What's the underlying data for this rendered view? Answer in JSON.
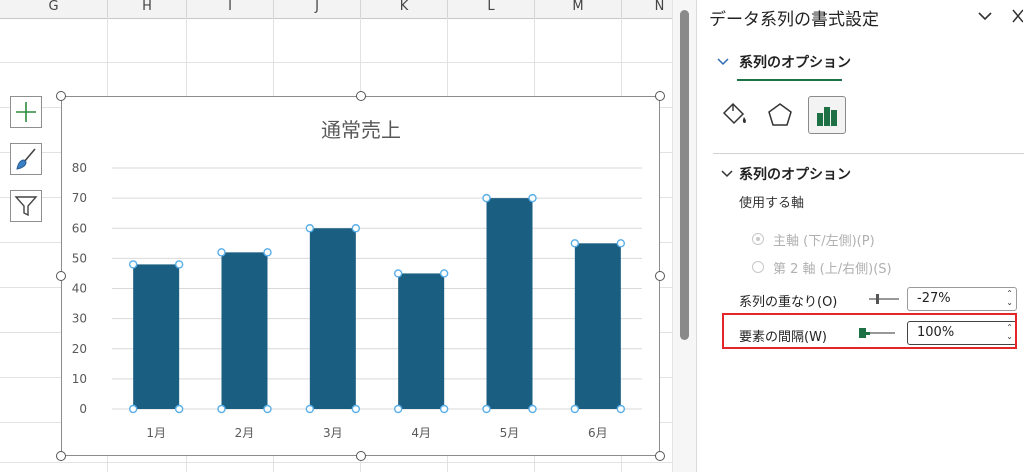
{
  "sheet": {
    "columns": [
      "G",
      "H",
      "I",
      "J",
      "K",
      "L",
      "M",
      "N"
    ]
  },
  "chart_data": {
    "type": "bar",
    "title": "通常売上",
    "categories": [
      "1月",
      "2月",
      "3月",
      "4月",
      "5月",
      "6月"
    ],
    "values": [
      48,
      52,
      60,
      45,
      70,
      55
    ],
    "yticks": [
      0,
      10,
      20,
      30,
      40,
      50,
      60,
      70,
      80
    ],
    "ylim": [
      0,
      80
    ],
    "grid": true,
    "bar_color": "#1a5e82",
    "selection_color": "#5aaee8"
  },
  "chart_buttons": {
    "elements": "plus-icon",
    "styles": "brush-icon",
    "filter": "funnel-icon"
  },
  "pane": {
    "title": "データ系列の書式設定",
    "tab_label": "系列のオプション",
    "section_label": "系列のオプション",
    "axis_label": "使用する軸",
    "primary_axis": "主軸 (下/左側)(P)",
    "secondary_axis": "第 2 軸 (上/右側)(S)",
    "overlap_label": "系列の重なり(O)",
    "overlap_value": "-27%",
    "gap_label": "要素の間隔(W)",
    "gap_value": "100%",
    "accent_color": "#1e7145",
    "highlight_color": "#e2262a"
  }
}
